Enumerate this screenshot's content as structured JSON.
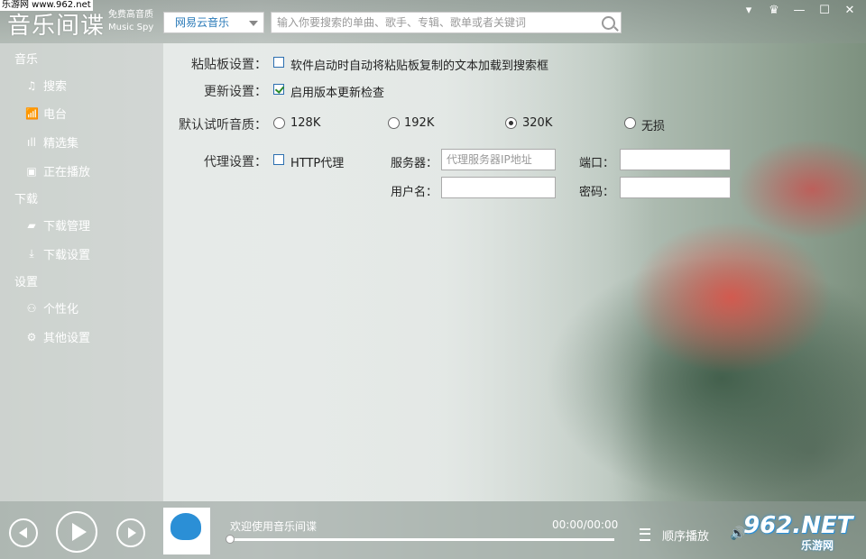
{
  "app": {
    "logo_text": "音乐间谍",
    "logo_tagline": "免费高音质",
    "logo_tagline2": "Music  Spy",
    "watermark_top": "乐游网 www.962.net"
  },
  "toolbar": {
    "source_selected": "网易云音乐",
    "search_placeholder": "输入你要搜索的单曲、歌手、专辑、歌单或者关键词"
  },
  "window_buttons": [
    "dropdown-icon",
    "skin-icon",
    "minimize-icon",
    "maximize-icon",
    "close-icon"
  ],
  "sidebar": {
    "sections": [
      {
        "title": "音乐",
        "items": [
          {
            "icon": "music-note-icon",
            "label": "搜索"
          },
          {
            "icon": "radio-icon",
            "label": "电台"
          },
          {
            "icon": "bars-icon",
            "label": "精选集"
          },
          {
            "icon": "play-screen-icon",
            "label": "正在播放"
          }
        ]
      },
      {
        "title": "下载",
        "items": [
          {
            "icon": "folder-icon",
            "label": "下载管理"
          },
          {
            "icon": "download-icon",
            "label": "下载设置"
          }
        ]
      },
      {
        "title": "设置",
        "items": [
          {
            "icon": "user-icon",
            "label": "个性化"
          },
          {
            "icon": "gear-icon",
            "label": "其他设置"
          }
        ]
      }
    ]
  },
  "settings": {
    "clipboard_label": "粘贴板设置：",
    "clipboard_option": "软件启动时自动将粘贴板复制的文本加载到搜索框",
    "clipboard_checked": false,
    "update_label": "更新设置：",
    "update_option": "启用版本更新检查",
    "update_checked": true,
    "quality_label": "默认试听音质：",
    "quality_options": [
      "128K",
      "192K",
      "320K",
      "无损"
    ],
    "quality_selected": "320K",
    "proxy_label": "代理设置：",
    "proxy_option": "HTTP代理",
    "proxy_checked": false,
    "server_label": "服务器：",
    "server_placeholder": "代理服务器IP地址",
    "port_label": "端口：",
    "username_label": "用户名：",
    "password_label": "密码："
  },
  "player": {
    "welcome": "欢迎使用音乐间谍",
    "time": "00:00/00:00",
    "progress": 0,
    "play_mode": "顺序播放"
  },
  "watermark": {
    "big": "962.NET",
    "small": "乐游网"
  }
}
